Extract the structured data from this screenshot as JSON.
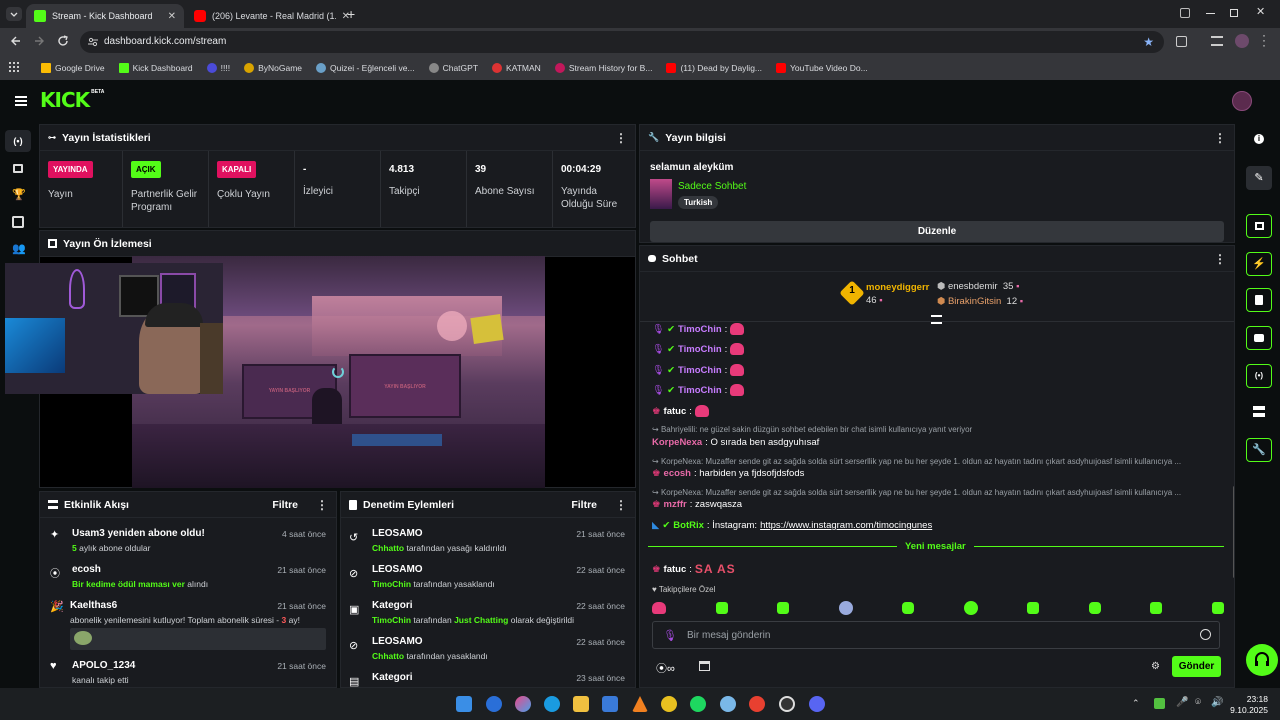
{
  "browser": {
    "tabs": [
      {
        "title": "Stream - Kick Dashboard",
        "color": "#53fc18"
      },
      {
        "title": "(206) Levante - Real Madrid (1...",
        "color": "#ff0000"
      }
    ],
    "url": "dashboard.kick.com/stream",
    "bookmarks": [
      "Google Drive",
      "Kick Dashboard",
      "!!!!",
      "ByNoGame",
      "Quizei - Eğlenceli ve...",
      "ChatGPT",
      "KATMAN",
      "Stream History for B...",
      "(11) Dead by Daylig...",
      "YouTube Video Do..."
    ]
  },
  "kick": {
    "logo": "KICK",
    "logo_sup": "BETA",
    "accent": "#53fc18"
  },
  "stats": {
    "title": "Yayın İstatistikleri",
    "items": [
      {
        "badge": "YAYINDA",
        "label": "Yayın"
      },
      {
        "badge": "AÇIK",
        "label": "Partnerlik Gelir Programı"
      },
      {
        "badge": "KAPALI",
        "label": "Çoklu Yayın"
      },
      {
        "value": "-",
        "label": "İzleyici"
      },
      {
        "value": "4.813",
        "label": "Takipçi"
      },
      {
        "value": "39",
        "label": "Abone Sayısı"
      },
      {
        "value": "00:04:29",
        "label": "Yayında Olduğu Süre"
      }
    ]
  },
  "preview": {
    "title": "Yayın Ön İzlemesi"
  },
  "activity": {
    "title": "Etkinlik Akışı",
    "filter": "Filtre",
    "items": [
      {
        "name": "Usam3 yeniden abone oldu!",
        "hl": "5",
        "rest": " aylık abone oldular",
        "time": "4 saat önce"
      },
      {
        "name": "ecosh",
        "hl": "Bir kedime ödül maması ver",
        "rest": " alındı",
        "time": "21 saat önce"
      },
      {
        "name": "Kaelthas6",
        "pre": "abonelik yenilemesini kutluyor! Toplam abonelik süresi - ",
        "hl": "3",
        "rest": " ay!",
        "time": "21 saat önce"
      },
      {
        "name": "APOLO_1234",
        "rest": "kanalı takip etti",
        "time": "21 saat önce"
      }
    ]
  },
  "moderation": {
    "title": "Denetim Eylemleri",
    "filter": "Filtre",
    "items": [
      {
        "name": "LEOSAMO",
        "hl": "Chhatto",
        "rest": " tarafından yasağı kaldırıldı",
        "time": "21 saat önce"
      },
      {
        "name": "LEOSAMO",
        "hl": "TimoChin",
        "rest": " tarafından yasaklandı",
        "time": "22 saat önce"
      },
      {
        "name": "Kategori",
        "hl": "TimoChin",
        "rest": " tarafından ",
        "hl2": "Just Chatting",
        "rest2": " olarak değiştirildi",
        "time": "22 saat önce"
      },
      {
        "name": "LEOSAMO",
        "hl": "Chhatto",
        "rest": " tarafından yasaklandı",
        "time": "22 saat önce"
      },
      {
        "name": "Kategori",
        "time": "23 saat önce"
      }
    ]
  },
  "info": {
    "title": "Yayın bilgisi",
    "stream_title": "selamun aleyküm",
    "category": "Sadece Sohbet",
    "language": "Turkish",
    "edit": "Düzenle"
  },
  "chat": {
    "title": "Sohbet",
    "top": [
      {
        "rank": "1",
        "name": "moneydiggerr",
        "count": "46"
      },
      {
        "name": "enesbdemir",
        "count": "35"
      },
      {
        "name": "BirakinGitsin",
        "count": "12"
      }
    ],
    "messages": [
      {
        "user": "TimoChin",
        "color": "#c77dff",
        "text": ":"
      },
      {
        "user": "TimoChin",
        "color": "#c77dff",
        "text": ":"
      },
      {
        "user": "TimoChin",
        "color": "#c77dff",
        "text": ":"
      },
      {
        "user": "TimoChin",
        "color": "#c77dff",
        "text": ":"
      },
      {
        "user": "fatuc",
        "color": "#ffffff",
        "text": ":"
      }
    ],
    "reply1": "Bahriyelili: ne güzel sakin düzgün sohbet edebilen bir chat isimli kullanıcıya yanıt veriyor",
    "msg_korpe": {
      "user": "KorpeNexa",
      "text": ": O sırada ben asdgyuhısaf"
    },
    "reply2": "KorpeNexa: Muzaffer sende git az sağda solda sürt serserllik yap ne bu her şeyde 1. oldun az hayatın tadını çıkart asdyhuıjoasf isimli kullanıcıya ...",
    "msg_ecosh": {
      "user": "ecosh",
      "text": ": harbiden ya fjdsofjdsfods"
    },
    "reply3": "KorpeNexa: Muzaffer sende git az sağda solda sürt serserllik yap ne bu her şeyde 1. oldun az hayatın tadını çıkart asdyhuıjoasf isimli kullanıcıya ...",
    "msg_mzffr": {
      "user": "mzffr",
      "text": ": zaswqasza"
    },
    "msg_botrix": {
      "user": "BotRix",
      "pre": ": İnstagram: ",
      "link": "https://www.instagram.com/timocingunes"
    },
    "new_messages": "Yeni mesajlar",
    "msg_fatuc": {
      "user": "fatuc",
      "text": ":",
      "big": "SA AS"
    },
    "followers_label": "Takipçilere Özel",
    "placeholder": "Bir mesaj gönderin",
    "send": "Gönder"
  },
  "taskbar": {
    "time": "23:18",
    "date": "9.10.2025"
  }
}
